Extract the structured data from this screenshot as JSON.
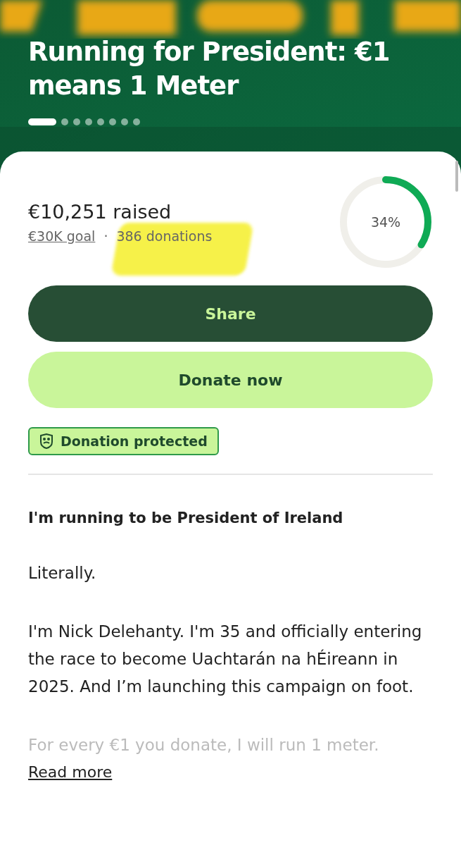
{
  "hero": {
    "title": "Running for President: €1 means 1 Meter",
    "slides": [
      {
        "selected": true
      },
      {
        "selected": false
      },
      {
        "selected": false
      },
      {
        "selected": false
      },
      {
        "selected": false
      },
      {
        "selected": false
      },
      {
        "selected": false
      },
      {
        "selected": false
      }
    ]
  },
  "progress": {
    "raised": "€10,251 raised",
    "goal": "€30K goal",
    "separator": "·",
    "donations": "386 donations",
    "percent": "34%",
    "level": 0.34
  },
  "buttons": [
    {
      "kind": "share",
      "label": "Share"
    },
    {
      "kind": "donate",
      "label": "Donate now"
    }
  ],
  "badge": {
    "label": "Donation protected"
  },
  "story": {
    "heading": "I'm running to be President of Ireland",
    "paragraphs": [
      {
        "text": "Literally.",
        "faded": false
      },
      {
        "text": "I'm Nick Delehanty. I'm 35 and officially entering the race to become Uachtarán na hÉireann in 2025. And I’m launching this campaign on foot.",
        "faded": false
      },
      {
        "text": "For every €1 you donate, I will run 1 meter.",
        "faded": true
      }
    ],
    "read_more": "Read more"
  }
}
